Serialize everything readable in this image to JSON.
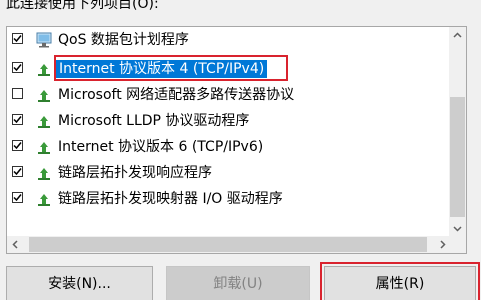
{
  "heading": "此连接使用下列项目(O):",
  "components": [
    {
      "label": "QoS 数据包计划程序",
      "checked": true,
      "icon": "qos-scheduler-icon",
      "selected": false
    },
    {
      "label": "Internet 协议版本 4 (TCP/IPv4)",
      "checked": true,
      "icon": "network-protocol-icon",
      "selected": true
    },
    {
      "label": "Microsoft 网络适配器多路传送器协议",
      "checked": false,
      "icon": "network-protocol-icon",
      "selected": false
    },
    {
      "label": "Microsoft LLDP 协议驱动程序",
      "checked": true,
      "icon": "network-protocol-icon",
      "selected": false
    },
    {
      "label": "Internet 协议版本 6 (TCP/IPv6)",
      "checked": true,
      "icon": "network-protocol-icon",
      "selected": false
    },
    {
      "label": "链路层拓扑发现响应程序",
      "checked": true,
      "icon": "network-protocol-icon",
      "selected": false
    },
    {
      "label": "链路层拓扑发现映射器 I/O 驱动程序",
      "checked": true,
      "icon": "network-protocol-icon",
      "selected": false
    }
  ],
  "buttons": {
    "install": "安装(N)...",
    "uninstall": "卸载(U)",
    "properties": "属性(R)"
  },
  "colors": {
    "selection": "#0078d7",
    "highlight_outline": "#d9232e",
    "protocol_icon": "#3a9a3a"
  }
}
